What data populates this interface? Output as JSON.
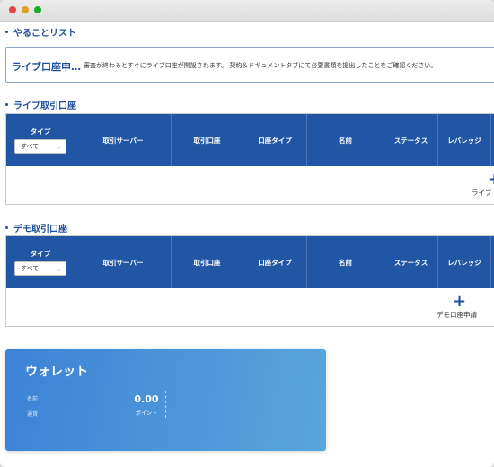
{
  "todo": {
    "title": "やることリスト",
    "notice_strong": "ライブ口座申…",
    "notice_text": "審査が終わるとすぐにライブ口座が開設されます。 契約＆ドキュメントタブにて必要書類を提出したことをご確認ください。"
  },
  "live": {
    "title": "ライブ取引口座",
    "add_label": "ライブ"
  },
  "demo": {
    "title": "デモ取引口座",
    "add_label": "デモ口座申請"
  },
  "columns": {
    "type": "タイプ",
    "type_select": "すべて",
    "server": "取引サーバー",
    "account": "取引口座",
    "account_type": "口座タイプ",
    "name": "名前",
    "status": "ステータス",
    "leverage": "レバレッジ"
  },
  "icons": {
    "plus": "+",
    "chevron": "⌵"
  },
  "wallet": {
    "title": "ウォレット",
    "label1": "名前",
    "label2": "通貨",
    "value": "0.00",
    "unit": "ポイント"
  },
  "colors": {
    "header_blue": "#2156a5",
    "accent": "#1f4e9c",
    "wallet_start": "#3d82d6",
    "wallet_end": "#58a6dc"
  }
}
